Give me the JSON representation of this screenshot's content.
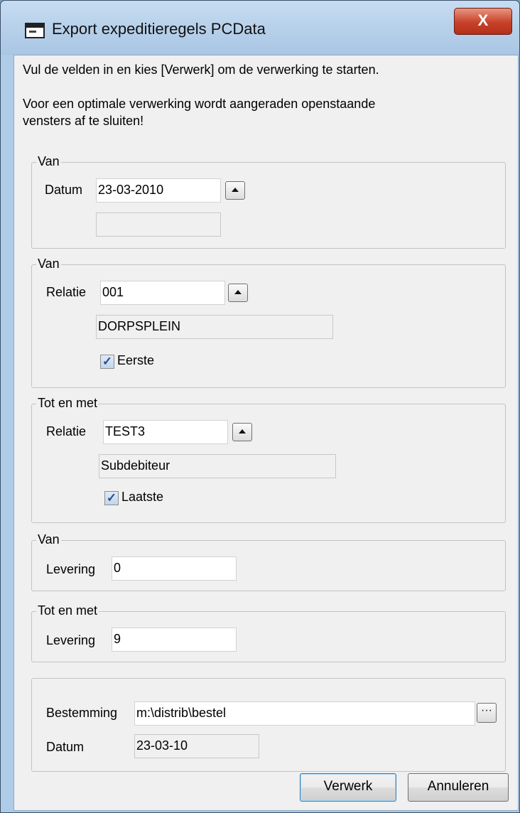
{
  "window": {
    "title": "Export expeditieregels PCData",
    "close_symbol": "X"
  },
  "intro": {
    "line1": "Vul de velden in en kies [Verwerk] om de verwerking te starten.",
    "line2": "Voor een optimale verwerking wordt aangeraden openstaande",
    "line3": "vensters af te sluiten!"
  },
  "group_datum": {
    "legend": "Van",
    "label": "Datum",
    "value": "23-03-2010",
    "extra": ""
  },
  "group_relatie_van": {
    "legend": "Van",
    "label": "Relatie",
    "value": "001",
    "name": "DORPSPLEIN",
    "checkbox_label": "Eerste",
    "checkbox_checked": true
  },
  "group_relatie_tot": {
    "legend": "Tot en met",
    "label": "Relatie",
    "value": "TEST3",
    "name": "Subdebiteur",
    "checkbox_label": "Laatste",
    "checkbox_checked": true
  },
  "group_levering_van": {
    "legend": "Van",
    "label": "Levering",
    "value": "0"
  },
  "group_levering_tot": {
    "legend": "Tot en met",
    "label": "Levering",
    "value": "9"
  },
  "group_bestemming": {
    "dest_label": "Bestemming",
    "dest_value": "m:\\distrib\\bestel",
    "date_label": "Datum",
    "date_value": "23-03-10"
  },
  "buttons": {
    "process": "Verwerk",
    "cancel": "Annuleren"
  },
  "check_mark": "✓",
  "ellipsis_symbol": "···"
}
